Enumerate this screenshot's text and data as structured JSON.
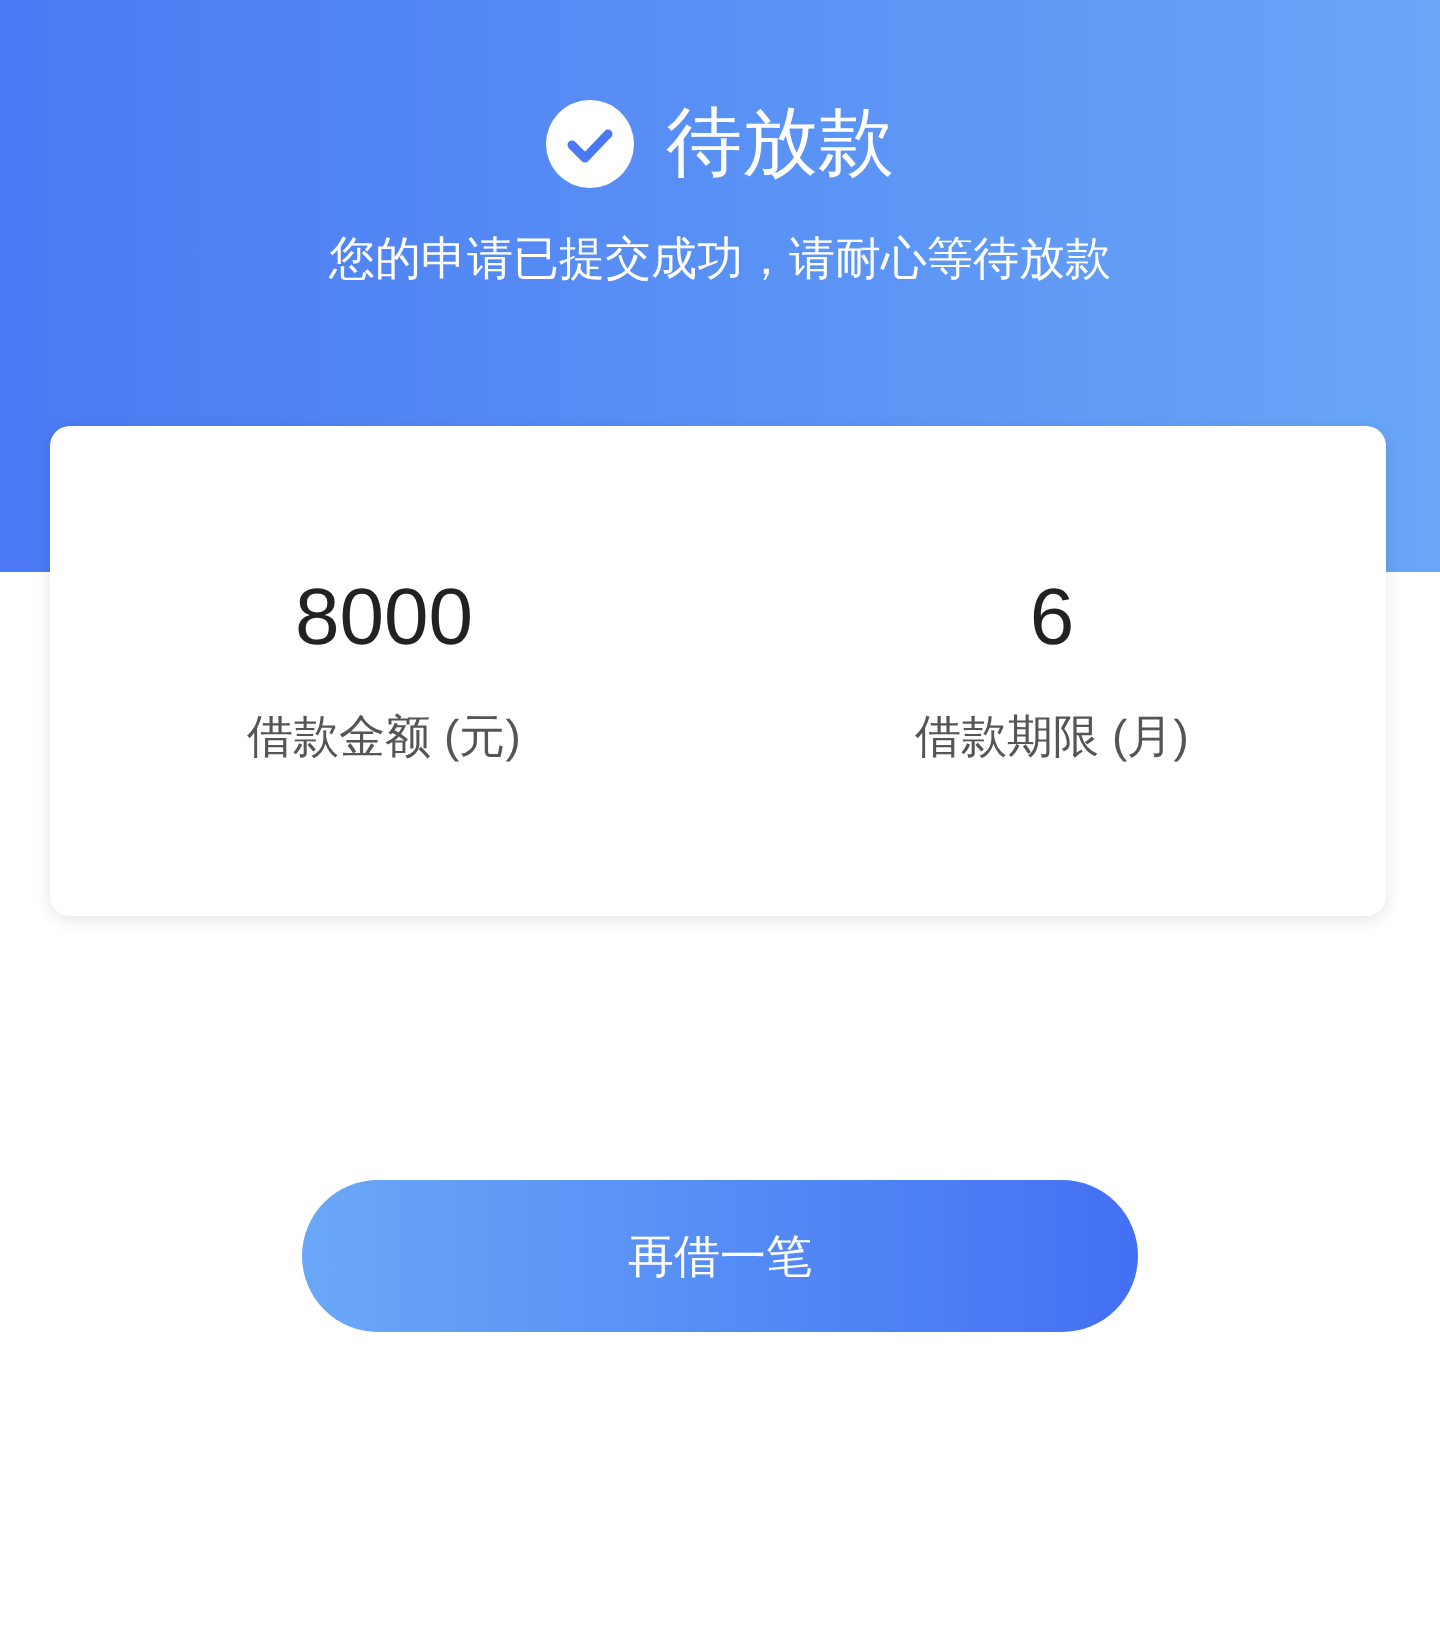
{
  "header": {
    "title": "待放款",
    "subtitle": "您的申请已提交成功，请耐心等待放款"
  },
  "summary": [
    {
      "value": "8000",
      "label": "借款金额 (元)"
    },
    {
      "value": "6",
      "label": "借款期限 (月)"
    }
  ],
  "action_button": "再借一笔"
}
